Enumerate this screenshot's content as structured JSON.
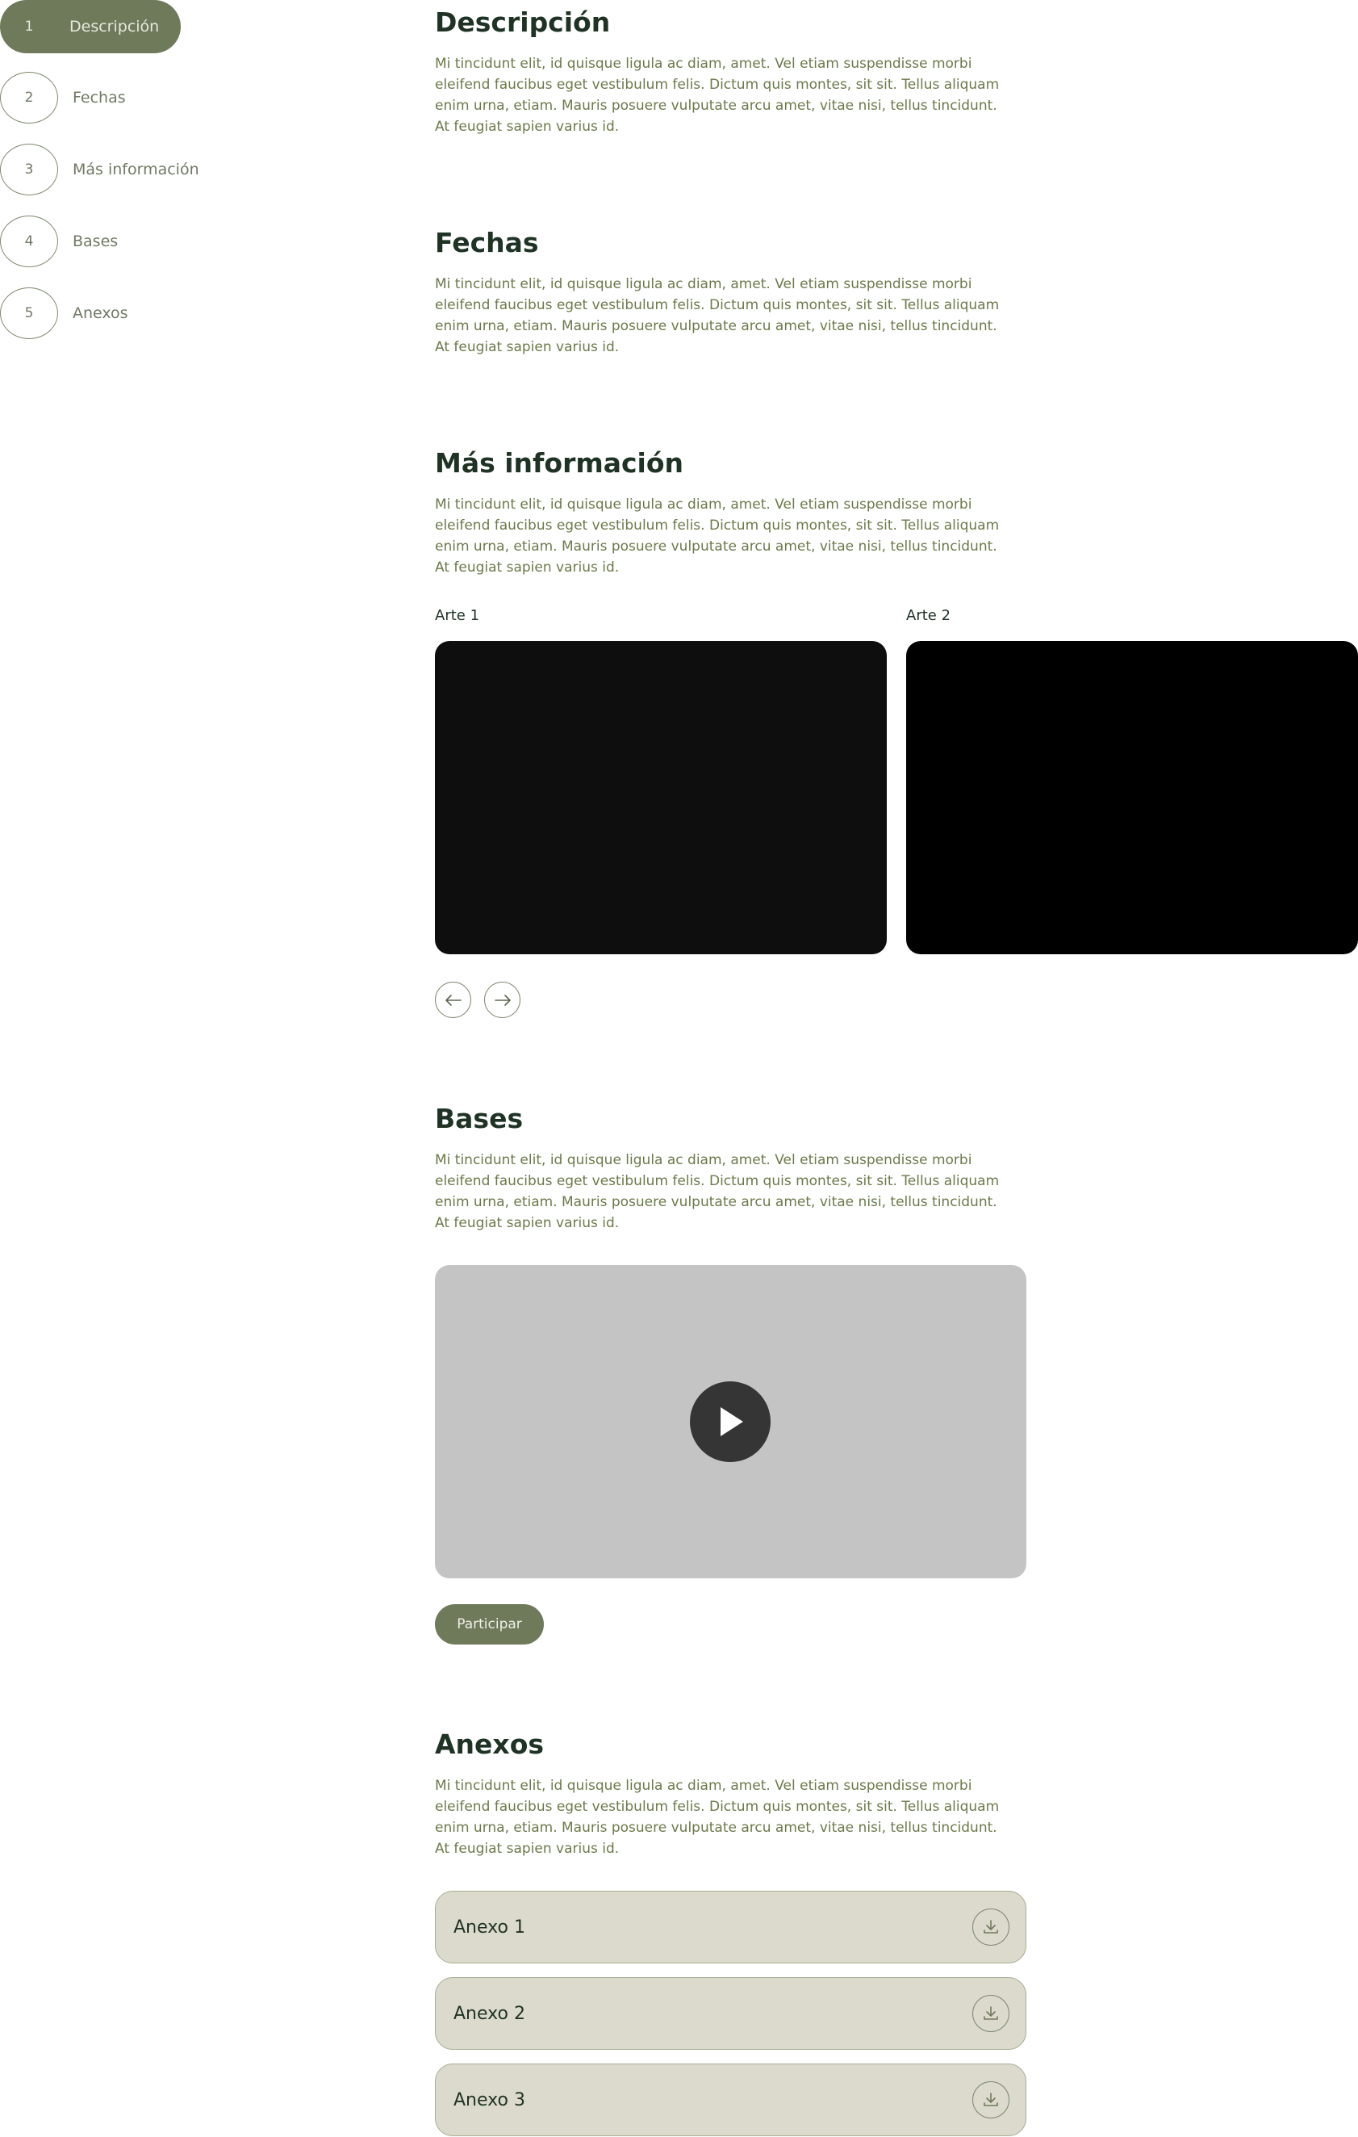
{
  "stepper": {
    "items": [
      {
        "num": "1",
        "label": "Descripción",
        "active": true
      },
      {
        "num": "2",
        "label": "Fechas",
        "active": false
      },
      {
        "num": "3",
        "label": "Más información",
        "active": false
      },
      {
        "num": "4",
        "label": "Bases",
        "active": false
      },
      {
        "num": "5",
        "label": "Anexos",
        "active": false
      }
    ]
  },
  "sections": {
    "descripcion": {
      "title": "Descripción",
      "text": "Mi tincidunt elit, id quisque ligula ac diam, amet. Vel etiam suspendisse morbi eleifend faucibus eget vestibulum felis. Dictum quis montes, sit sit. Tellus aliquam enim urna, etiam. Mauris posuere vulputate arcu amet, vitae nisi, tellus tincidunt. At feugiat sapien varius id."
    },
    "fechas": {
      "title": "Fechas",
      "text": "Mi tincidunt elit, id quisque ligula ac diam, amet. Vel etiam suspendisse morbi eleifend faucibus eget vestibulum felis. Dictum quis montes, sit sit. Tellus aliquam enim urna, etiam. Mauris posuere vulputate arcu amet, vitae nisi, tellus tincidunt. At feugiat sapien varius id."
    },
    "mas_informacion": {
      "title": "Más información",
      "text": "Mi tincidunt elit, id quisque ligula ac diam, amet. Vel etiam suspendisse morbi eleifend faucibus eget vestibulum felis. Dictum quis montes, sit sit. Tellus aliquam enim urna, etiam. Mauris posuere vulputate arcu amet, vitae nisi, tellus tincidunt. At feugiat sapien varius id.",
      "arts": [
        {
          "label": "Arte 1",
          "color": "#0e0e0e"
        },
        {
          "label": "Arte 2",
          "color": "#000000"
        }
      ]
    },
    "bases": {
      "title": "Bases",
      "text": "Mi tincidunt elit, id quisque ligula ac diam, amet. Vel etiam suspendisse morbi eleifend faucibus eget vestibulum felis. Dictum quis montes, sit sit. Tellus aliquam enim urna, etiam. Mauris posuere vulputate arcu amet, vitae nisi, tellus tincidunt. At feugiat sapien varius id.",
      "participar_label": "Participar"
    },
    "anexos": {
      "title": "Anexos",
      "text": "Mi tincidunt elit, id quisque ligula ac diam, amet. Vel etiam suspendisse morbi eleifend faucibus eget vestibulum felis. Dictum quis montes, sit sit. Tellus aliquam enim urna, etiam. Mauris posuere vulputate arcu amet, vitae nisi, tellus tincidunt. At feugiat sapien varius id.",
      "items": [
        {
          "label": "Anexo 1"
        },
        {
          "label": "Anexo 2"
        },
        {
          "label": "Anexo 3"
        }
      ]
    }
  },
  "icons": {
    "prev": "arrow-left-icon",
    "next": "arrow-right-icon",
    "play": "play-icon",
    "download": "download-icon"
  },
  "colors": {
    "accent": "#6f7a5b",
    "heading": "#1f3325",
    "body_text": "#6b7a4a",
    "video_bg": "#c4c4c4",
    "annex_bg": "#dcdacd"
  }
}
